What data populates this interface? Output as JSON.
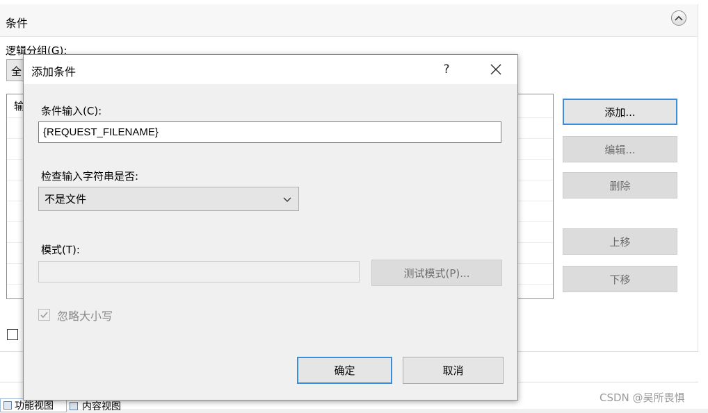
{
  "background": {
    "section_title": "条件",
    "logic_group_label": "逻辑分组(G):",
    "logic_group_value": "全",
    "list_header_stub": "输",
    "buttons": {
      "add": "添加...",
      "edit": "编辑...",
      "delete": "删除",
      "move_up": "上移",
      "move_down": "下移"
    },
    "tabs": {
      "feature_view": "功能视图",
      "content_view": "内容视图"
    }
  },
  "dialog": {
    "title": "添加条件",
    "help": "?",
    "condition_input_label": "条件输入(C):",
    "condition_input_value": "{REQUEST_FILENAME}",
    "check_label": "检查输入字符串是否:",
    "check_value": "不是文件",
    "pattern_label": "模式(T):",
    "pattern_value": "",
    "test_pattern_button": "测试模式(P)...",
    "ignore_case_label": "忽略大小写",
    "ignore_case_checked": true,
    "ok_button": "确定",
    "cancel_button": "取消"
  },
  "watermark": "CSDN @吴所畏惧",
  "colors": {
    "focus_border": "#3c8dd9",
    "disabled_text": "#6d6d6d",
    "dialog_bg": "#f0f0f0"
  }
}
